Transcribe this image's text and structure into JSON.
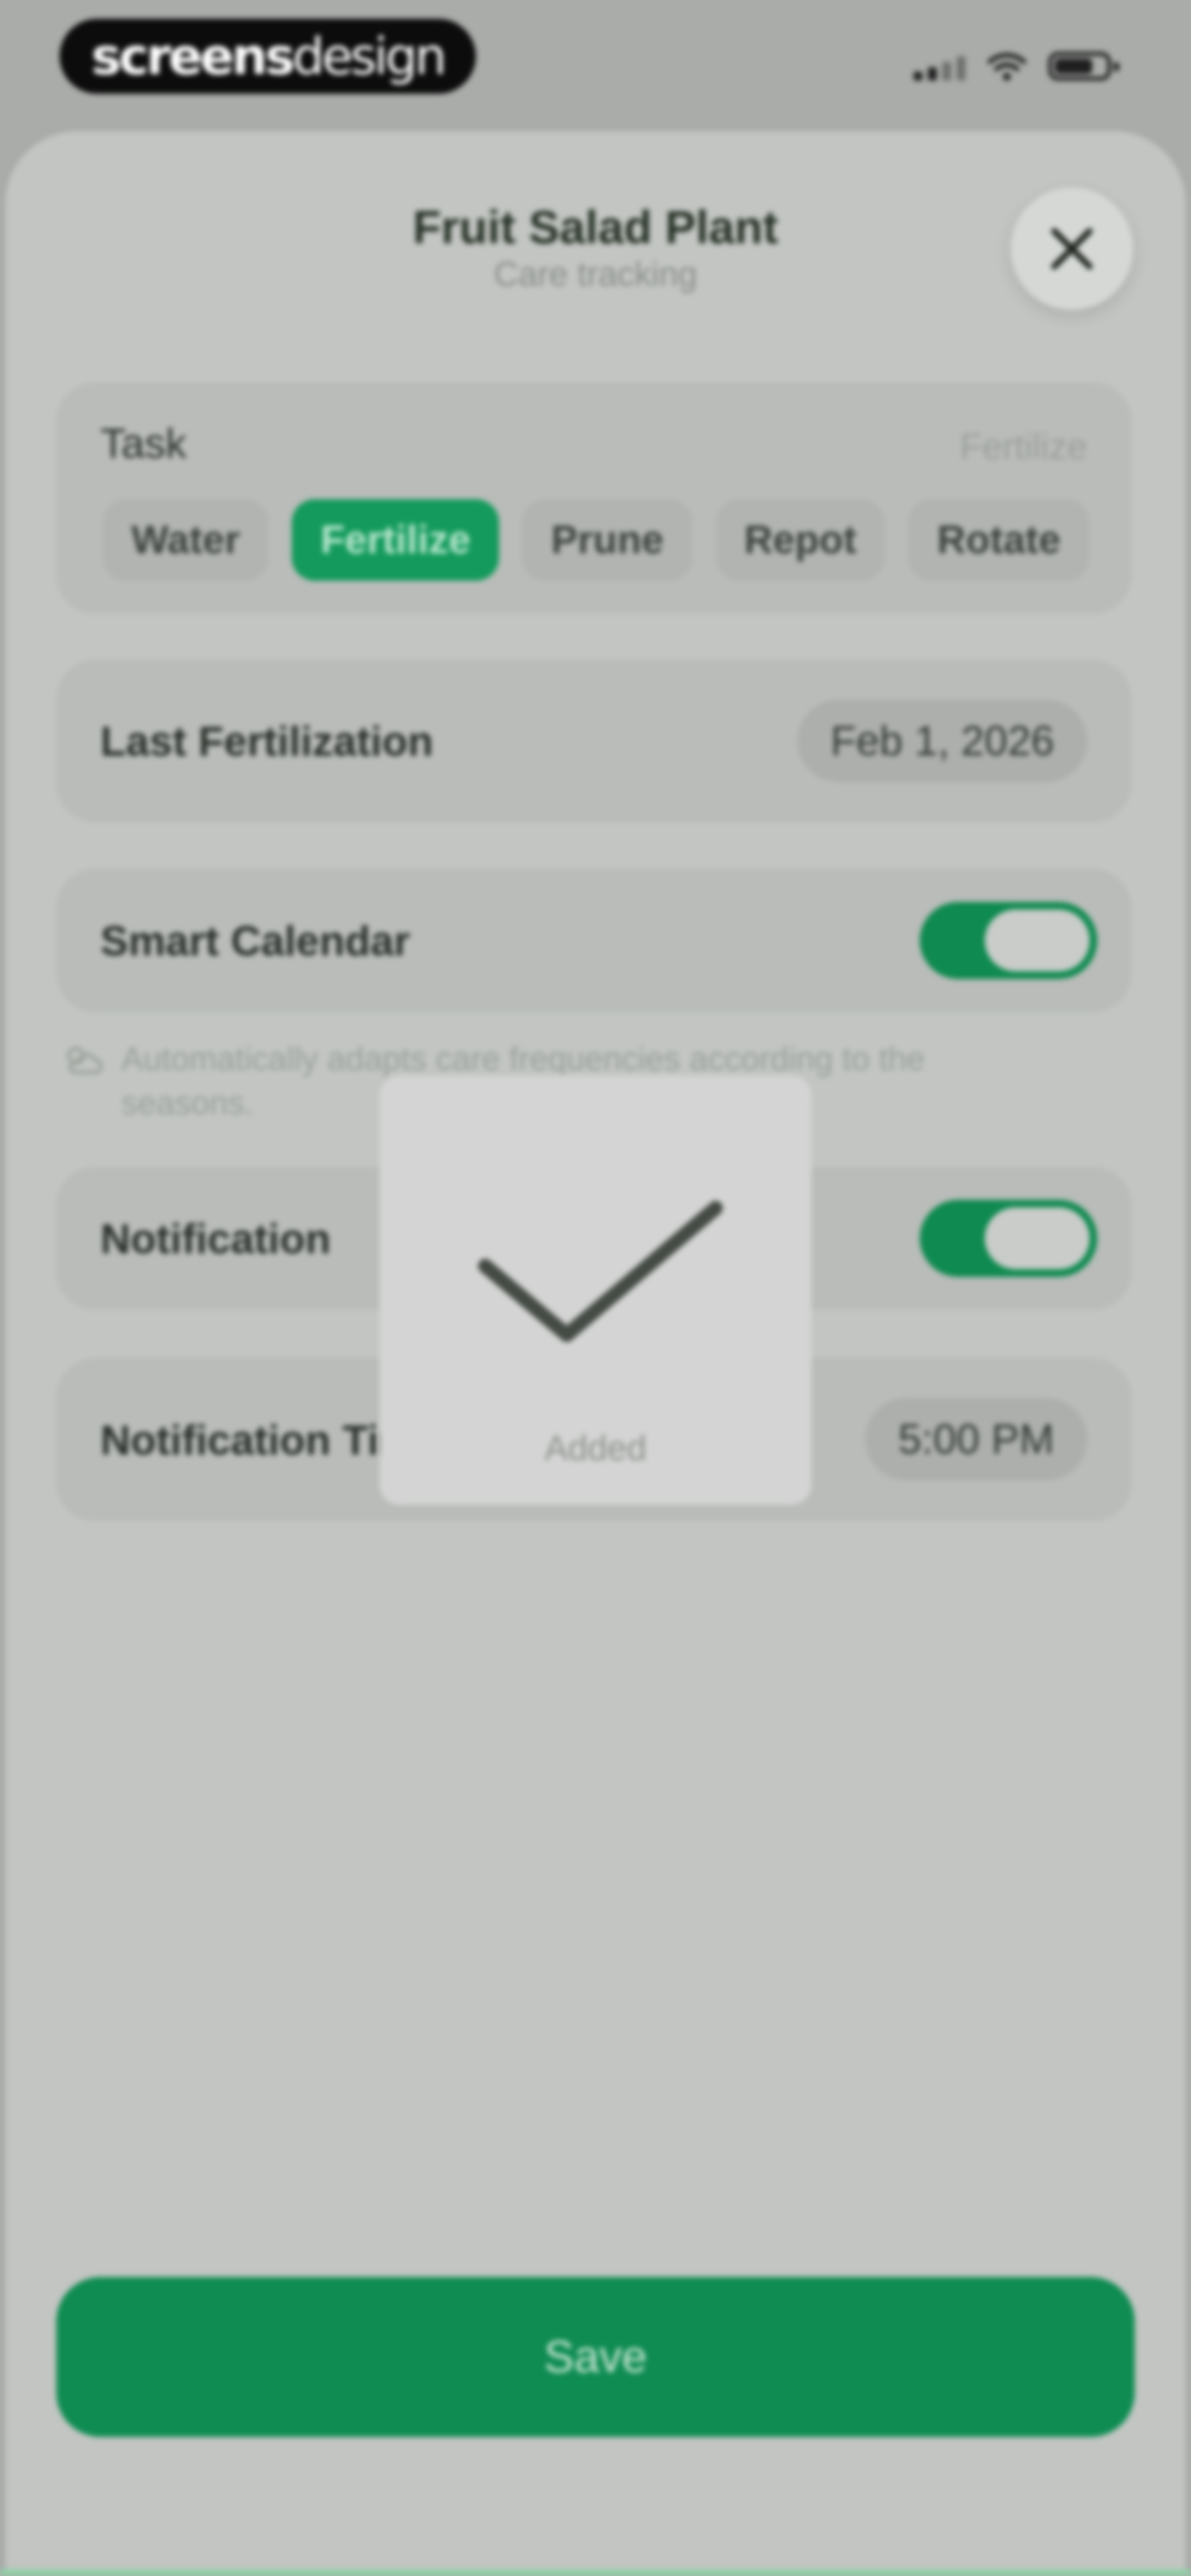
{
  "status_bar": {
    "brand_bold": "screens",
    "brand_light": "design"
  },
  "header": {
    "title": "Fruit Salad Plant",
    "subtitle": "Care tracking"
  },
  "task_card": {
    "label": "Task",
    "selected_value": "Fertilize",
    "options": [
      "Water",
      "Fertilize",
      "Prune",
      "Repot",
      "Rotate"
    ],
    "selected_index": 1
  },
  "last_fertilization": {
    "label": "Last Fertilization",
    "date": "Feb 1, 2026"
  },
  "smart_calendar": {
    "label": "Smart Calendar",
    "enabled": true,
    "note": "Automatically adapts care frequencies according to the seasons."
  },
  "notification": {
    "label": "Notification",
    "enabled": true
  },
  "notification_time": {
    "label": "Notification Time",
    "time": "5:00 PM"
  },
  "save_label": "Save",
  "hud": {
    "message": "Added"
  },
  "colors": {
    "accent": "#149a5c",
    "save_button": "#0f8c52",
    "overlay": "#a9aca9"
  }
}
